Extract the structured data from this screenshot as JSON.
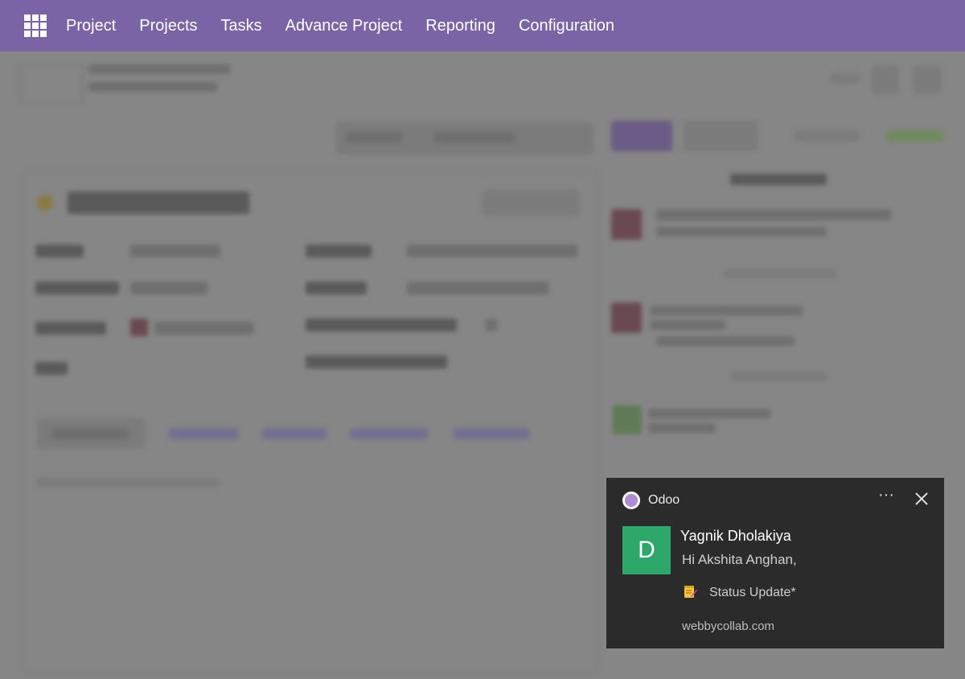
{
  "navbar": {
    "apps_icon": "grid-icon",
    "menu": [
      "Project",
      "Projects",
      "Tasks",
      "Advance Project",
      "Reporting",
      "Configuration"
    ]
  },
  "notification": {
    "app_name": "Odoo",
    "app_icon": "odoo-logo-icon",
    "sender": "Yagnik Dholakiya",
    "avatar_letter": "D",
    "avatar_color": "#2ea76b",
    "line1": "Hi Akshita Anghan,",
    "emoji": "memo-icon",
    "line2": "Status Update*",
    "source": "webbycollab.com"
  },
  "colors": {
    "navbar_bg": "#7b64a6",
    "overlay_bg": "#868686",
    "toast_bg": "#2b2b2b"
  }
}
